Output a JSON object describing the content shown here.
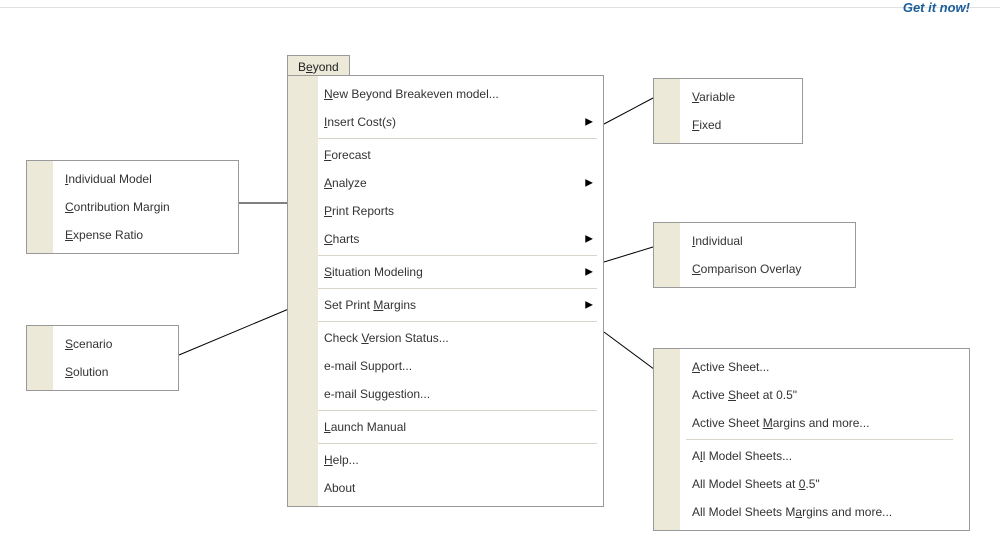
{
  "header": {
    "getit": "Get it now!"
  },
  "tab": {
    "label_pre": "B",
    "label_ul": "e",
    "label_post": "yond"
  },
  "main": {
    "new_model": "New Beyond Breakeven model...",
    "insert_cost": "Insert Cost(s)",
    "forecast": "Forecast",
    "analyze": "Analyze",
    "print_reports": "Print Reports",
    "charts": "Charts",
    "situation": "Situation Modeling",
    "set_margins": "Set Print Margins",
    "check_version": "Check Version Status...",
    "email_support": "e-mail Support...",
    "email_suggestion": "e-mail Suggestion...",
    "launch_manual": "Launch Manual",
    "help": "Help...",
    "about": "About"
  },
  "sub_insert": {
    "variable": "Variable",
    "fixed": "Fixed"
  },
  "sub_analyze": {
    "individual": "Individual Model",
    "contribution": "Contribution Margin",
    "expense": "Expense Ratio"
  },
  "sub_charts": {
    "individual": "Individual",
    "comparison": "Comparison Overlay"
  },
  "sub_situation": {
    "scenario": "Scenario",
    "solution": "Solution"
  },
  "sub_margins": {
    "active": "Active Sheet...",
    "active_05": "Active Sheet at 0.5\"",
    "active_more": "Active Sheet Margins and more...",
    "all": "All Model Sheets...",
    "all_05": "All Model Sheets at 0.5\"",
    "all_more": "All Model Sheets Margins and more..."
  },
  "underlines": {
    "new_model": "N",
    "insert_cost": "I",
    "forecast": "F",
    "analyze": "A",
    "print_reports": "P",
    "charts": "C",
    "situation": "S",
    "set_margins": "M",
    "check_version": "V",
    "launch_manual": "L",
    "help": "H",
    "variable": "V",
    "fixed": "F",
    "individual_model": "I",
    "contribution": "C",
    "expense": "E",
    "individual": "I",
    "comparison": "C",
    "scenario": "S",
    "solution": "S",
    "active": "A",
    "active_05": "S",
    "active_more": "M",
    "all": "l",
    "all_05": "0",
    "all_more": "a"
  }
}
